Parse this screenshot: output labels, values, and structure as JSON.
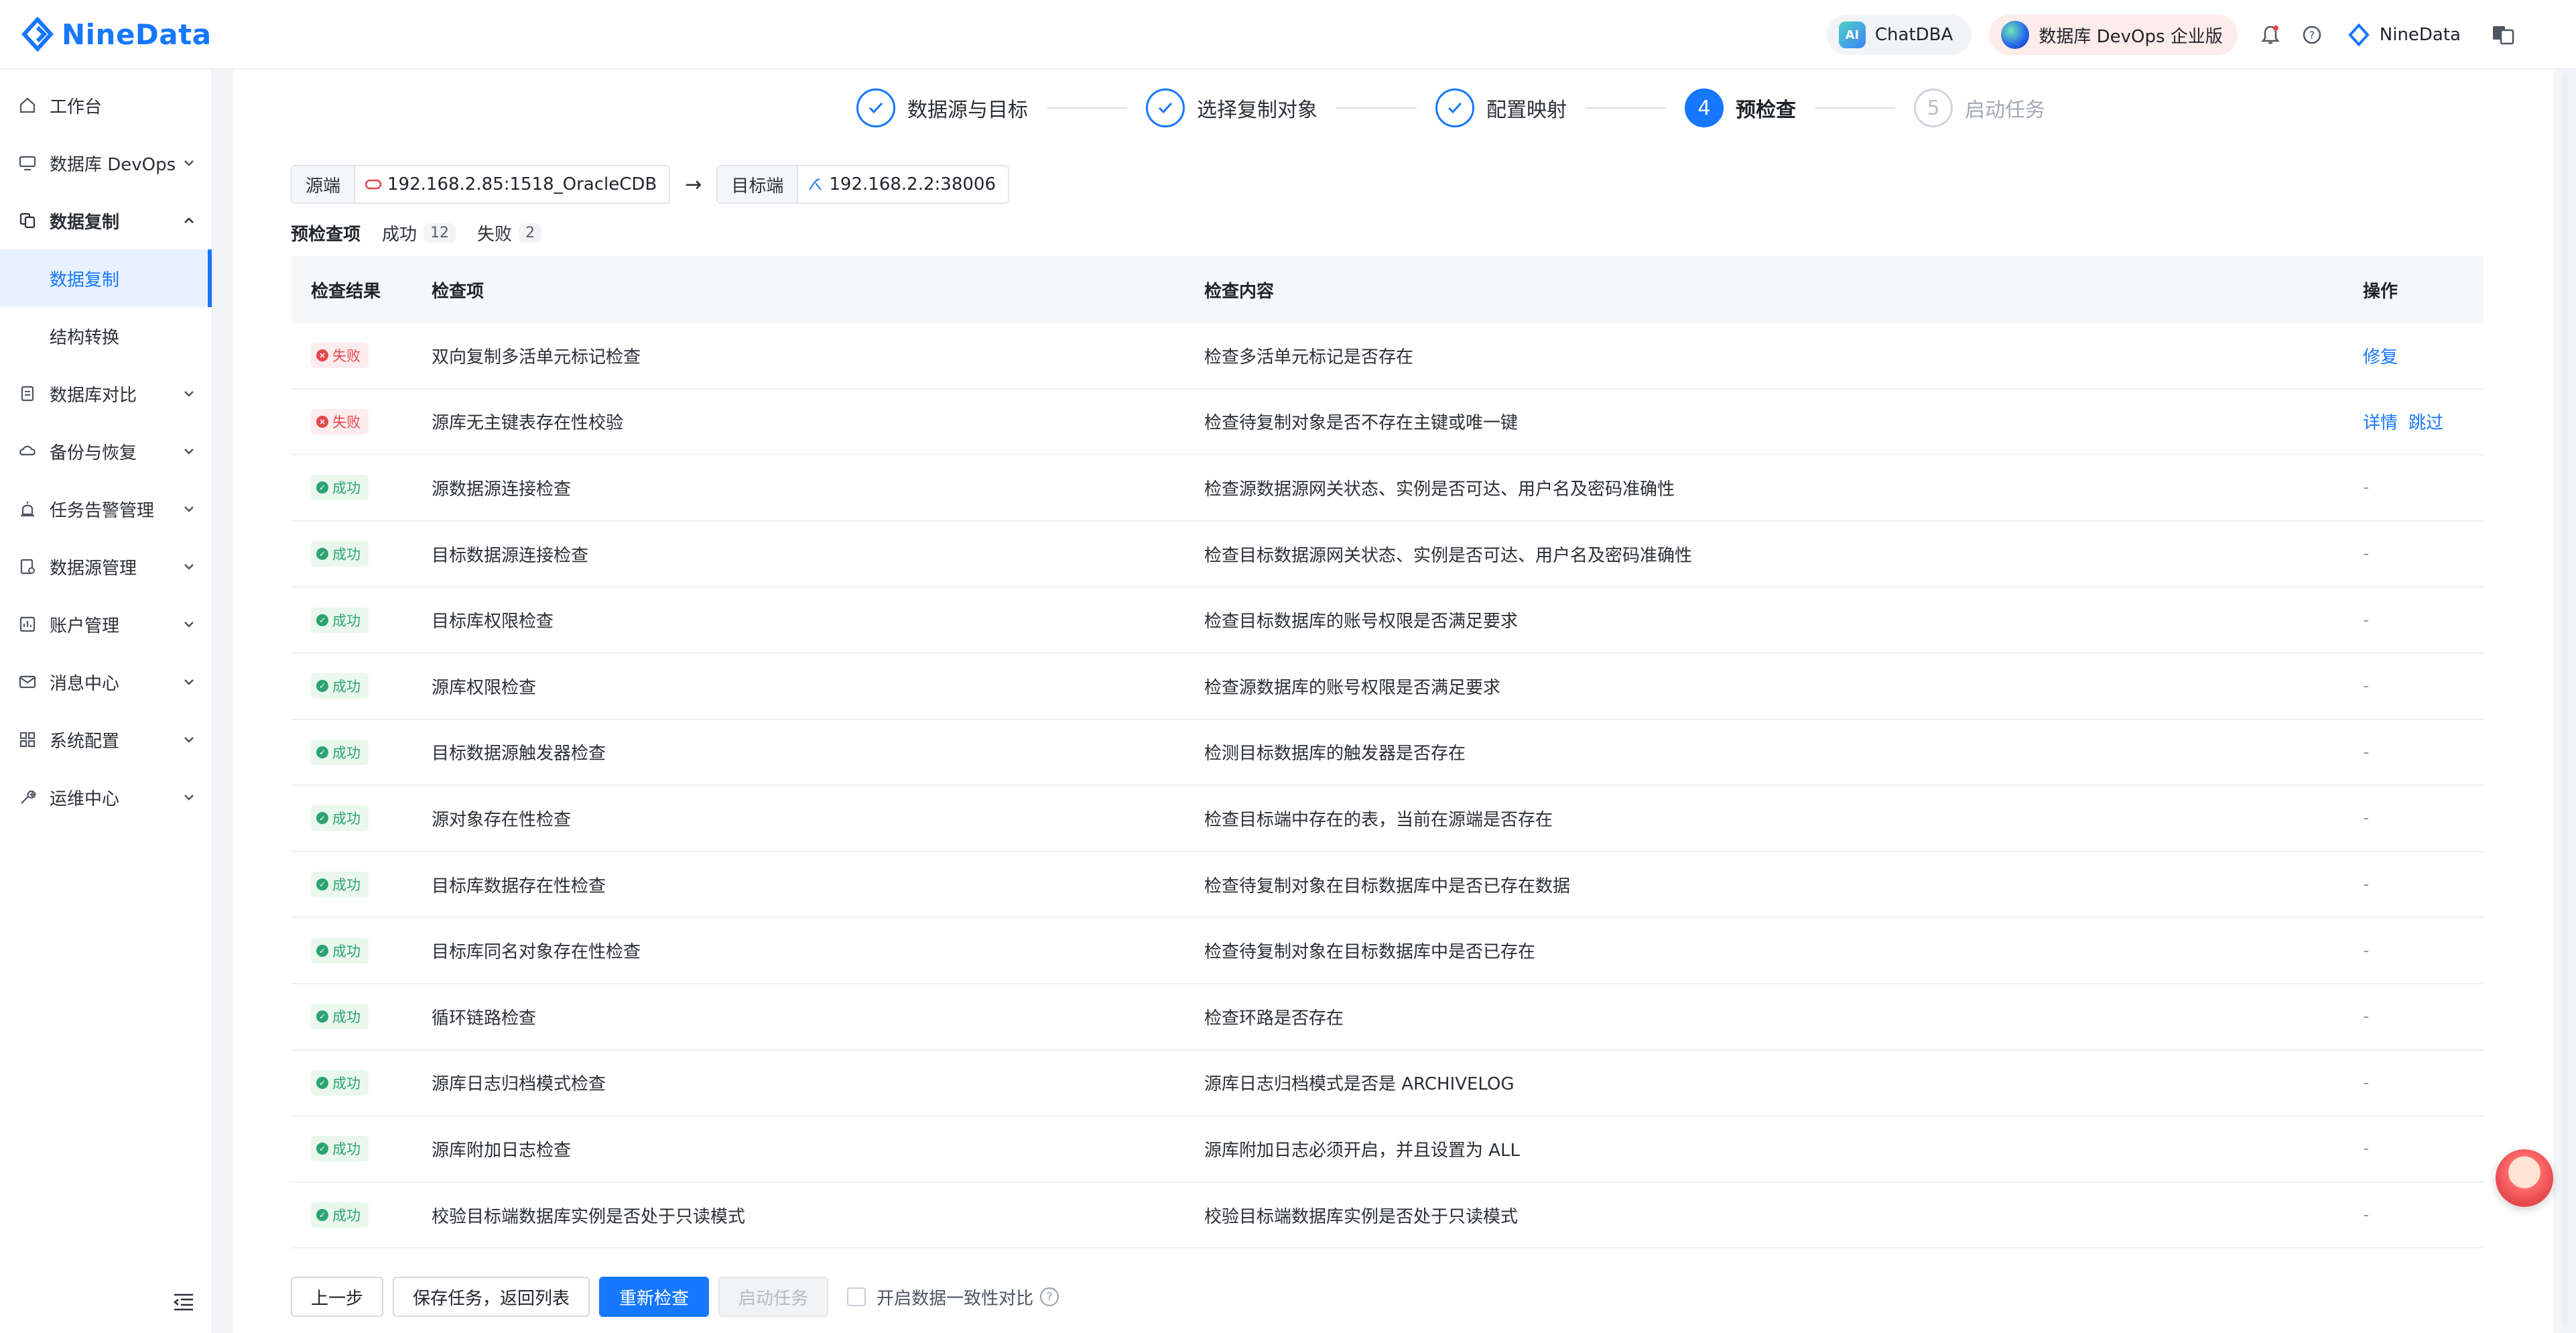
{
  "brand": {
    "name": "NineData"
  },
  "header": {
    "chatdba": "ChatDBA",
    "ai_badge": "AI",
    "devops": "数据库 DevOps 企业版",
    "user": "NineData"
  },
  "sidebar": {
    "items": [
      {
        "label": "工作台",
        "icon": "home-icon"
      },
      {
        "label": "数据库 DevOps",
        "icon": "monitor-icon"
      },
      {
        "label": "数据复制",
        "icon": "replicate-icon"
      },
      {
        "label": "数据库对比",
        "icon": "compare-icon"
      },
      {
        "label": "备份与恢复",
        "icon": "backup-icon"
      },
      {
        "label": "任务告警管理",
        "icon": "alarm-icon"
      },
      {
        "label": "数据源管理",
        "icon": "datasource-icon"
      },
      {
        "label": "账户管理",
        "icon": "account-icon"
      },
      {
        "label": "消息中心",
        "icon": "mail-icon"
      },
      {
        "label": "系统配置",
        "icon": "grid-icon"
      },
      {
        "label": "运维中心",
        "icon": "wrench-icon"
      }
    ],
    "sub": {
      "active": "数据复制",
      "other": "结构转换"
    }
  },
  "steps": [
    {
      "label": "数据源与目标",
      "state": "done"
    },
    {
      "label": "选择复制对象",
      "state": "done"
    },
    {
      "label": "配置映射",
      "state": "done"
    },
    {
      "num": "4",
      "label": "预检查",
      "state": "current"
    },
    {
      "num": "5",
      "label": "启动任务",
      "state": "pending"
    }
  ],
  "connection": {
    "source_label": "源端",
    "source_value": "192.168.2.85:1518_OracleCDB",
    "target_label": "目标端",
    "target_value": "192.168.2.2:38006",
    "arrow": "→"
  },
  "filters": {
    "all": "预检查项",
    "success": "成功",
    "success_count": "12",
    "fail": "失败",
    "fail_count": "2"
  },
  "table": {
    "headers": [
      "检查结果",
      "检查项",
      "检查内容",
      "操作"
    ],
    "status": {
      "fail": "失败",
      "ok": "成功"
    },
    "rows": [
      {
        "status": "fail",
        "item": "双向复制多活单元标记检查",
        "content": "检查多活单元标记是否存在",
        "ops": [
          "修复"
        ]
      },
      {
        "status": "fail",
        "item": "源库无主键表存在性校验",
        "content": "检查待复制对象是否不存在主键或唯一键",
        "ops": [
          "详情",
          "跳过"
        ]
      },
      {
        "status": "ok",
        "item": "源数据源连接检查",
        "content": "检查源数据源网关状态、实例是否可达、用户名及密码准确性",
        "ops": []
      },
      {
        "status": "ok",
        "item": "目标数据源连接检查",
        "content": "检查目标数据源网关状态、实例是否可达、用户名及密码准确性",
        "ops": []
      },
      {
        "status": "ok",
        "item": "目标库权限检查",
        "content": "检查目标数据库的账号权限是否满足要求",
        "ops": []
      },
      {
        "status": "ok",
        "item": "源库权限检查",
        "content": "检查源数据库的账号权限是否满足要求",
        "ops": []
      },
      {
        "status": "ok",
        "item": "目标数据源触发器检查",
        "content": "检测目标数据库的触发器是否存在",
        "ops": []
      },
      {
        "status": "ok",
        "item": "源对象存在性检查",
        "content": "检查目标端中存在的表，当前在源端是否存在",
        "ops": []
      },
      {
        "status": "ok",
        "item": "目标库数据存在性检查",
        "content": "检查待复制对象在目标数据库中是否已存在数据",
        "ops": []
      },
      {
        "status": "ok",
        "item": "目标库同名对象存在性检查",
        "content": "检查待复制对象在目标数据库中是否已存在",
        "ops": []
      },
      {
        "status": "ok",
        "item": "循环链路检查",
        "content": "检查环路是否存在",
        "ops": []
      },
      {
        "status": "ok",
        "item": "源库日志归档模式检查",
        "content": "源库日志归档模式是否是 ARCHIVELOG",
        "ops": []
      },
      {
        "status": "ok",
        "item": "源库附加日志检查",
        "content": "源库附加日志必须开启，并且设置为 ALL",
        "ops": []
      },
      {
        "status": "ok",
        "item": "校验目标端数据库实例是否处于只读模式",
        "content": "校验目标端数据库实例是否处于只读模式",
        "ops": []
      }
    ],
    "empty_op": "-"
  },
  "footer": {
    "prev": "上一步",
    "save": "保存任务，返回列表",
    "recheck": "重新检查",
    "start": "启动任务",
    "consistency": "开启数据一致性对比",
    "help": "?"
  }
}
